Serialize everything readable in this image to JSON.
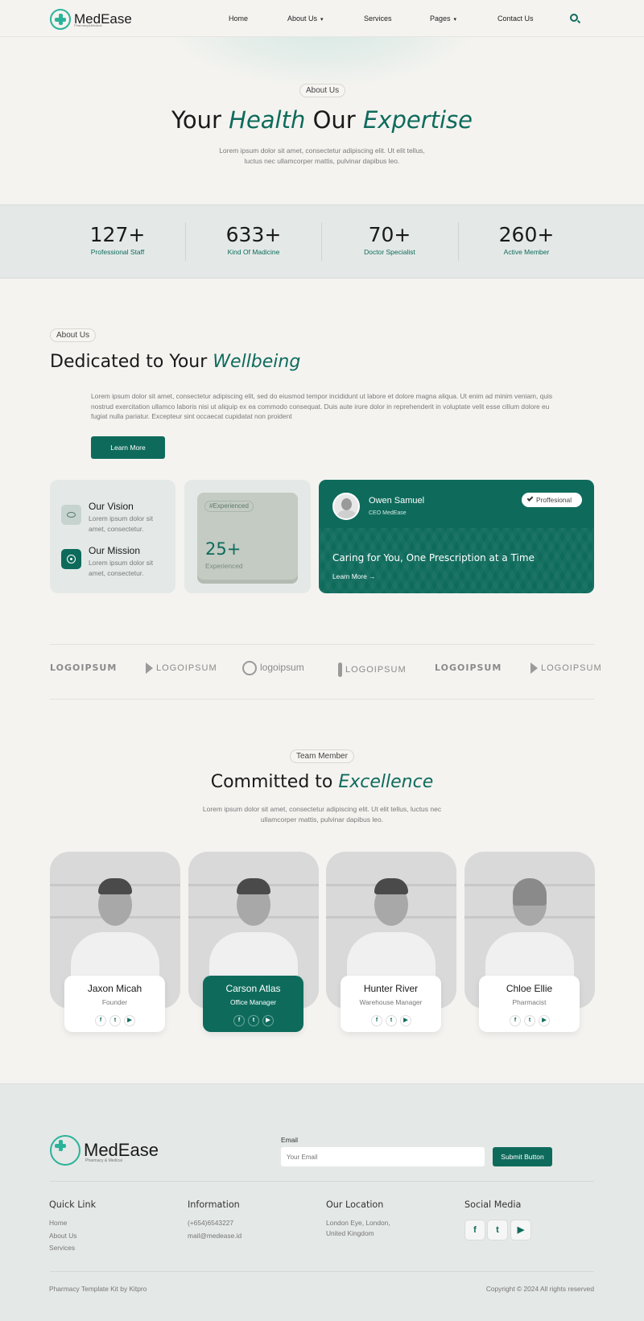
{
  "header": {
    "logo_text": "MedEase",
    "logo_sub": "Pharmacy&Medical",
    "nav": [
      {
        "label": "Home"
      },
      {
        "label": "About Us"
      },
      {
        "label": "Services"
      },
      {
        "label": "Pages"
      },
      {
        "label": "Contact Us"
      }
    ]
  },
  "hero": {
    "pill": "About Us",
    "title_a": "Your ",
    "title_b": "Health",
    "title_c": " Our ",
    "title_d": "Expertise",
    "text_1": "Lorem ipsum dolor sit amet, consectetur adipiscing elit. Ut elit tellus,",
    "text_2": "luctus nec ullamcorper mattis, pulvinar dapibus leo."
  },
  "stats": [
    {
      "num": "127+",
      "label": "Professional Staff"
    },
    {
      "num": "633+",
      "label": "Kind Of Madicine"
    },
    {
      "num": "70+",
      "label": "Doctor Specialist"
    },
    {
      "num": "260+",
      "label": "Active Member"
    }
  ],
  "about": {
    "pill": "About Us",
    "title_a": "Dedicated to Your ",
    "title_b": "Wellbeing",
    "text": "Lorem ipsum dolor sit amet, consectetur adipiscing elit, sed do eiusmod tempor incididunt ut labore et dolore magna aliqua. Ut enim ad minim veniam, quis nostrud exercitation ullamco laboris nisi ut aliquip ex ea commodo consequat. Duis aute irure dolor in reprehenderit in voluptate velit esse cillum dolore eu fugiat nulla pariatur. Excepteur sint occaecat cupidatat non proident",
    "button": "Learn More",
    "vision_title": "Our Vision",
    "vision_text": "Lorem ipsum dolor sit amet, consectetur.",
    "mission_title": "Our Mission",
    "mission_text": "Lorem ipsum dolor sit amet, consectetur.",
    "exp_tag": "#Experienced",
    "exp_num": "25+",
    "exp_label": "Experienced",
    "ceo_name": "Owen Samuel",
    "ceo_role": "CEO MedEase",
    "ceo_badge": "Proffesional",
    "ceo_quote": "Caring for You, One Prescription at a Time",
    "ceo_link": "Learn More →"
  },
  "logos": [
    "LOGOIPSUM",
    "LOGOIPSUM",
    "logoipsum",
    "LOGOIPSUM",
    "LOGOIPSUM",
    "LOGOIPSUM"
  ],
  "team": {
    "pill": "Team Member",
    "title_a": "Committed to ",
    "title_b": "Excellence",
    "text_1": "Lorem ipsum dolor sit amet, consectetur adipiscing elit. Ut elit tellus, luctus nec",
    "text_2": "ullamcorper mattis, pulvinar dapibus leo.",
    "members": [
      {
        "name": "Jaxon Micah",
        "role": "Founder"
      },
      {
        "name": "Carson Atlas",
        "role": "Office Manager"
      },
      {
        "name": "Hunter River",
        "role": "Warehouse Manager"
      },
      {
        "name": "Chloe Ellie",
        "role": "Pharmacist"
      }
    ]
  },
  "footer": {
    "logo_text": "MedEase",
    "logo_sub": "Pharmacy & Medical",
    "email_label": "Email",
    "email_placeholder": "Your Email",
    "submit": "Submit Button",
    "quick_title": "Quick Link",
    "quick_links": [
      "Home",
      "About Us",
      "Services"
    ],
    "info_title": "Information",
    "phone": "(+654)6543227",
    "mail": "mail@medease.id",
    "loc_title": "Our Location",
    "loc_1": "London Eye, London,",
    "loc_2": "United Kingdom",
    "social_title": "Social Media",
    "credit": "Pharmacy Template Kit by Kitpro",
    "copyright": "Copyright © 2024 All rights reserved"
  },
  "colors": {
    "accent": "#0e6b5c",
    "background": "#f4f3f0",
    "footer_bg": "#e4e8e6"
  },
  "icons": [
    "search-icon",
    "eye-icon",
    "target-icon",
    "check-icon",
    "facebook-icon",
    "twitter-icon",
    "youtube-icon",
    "arrow-right-icon"
  ]
}
